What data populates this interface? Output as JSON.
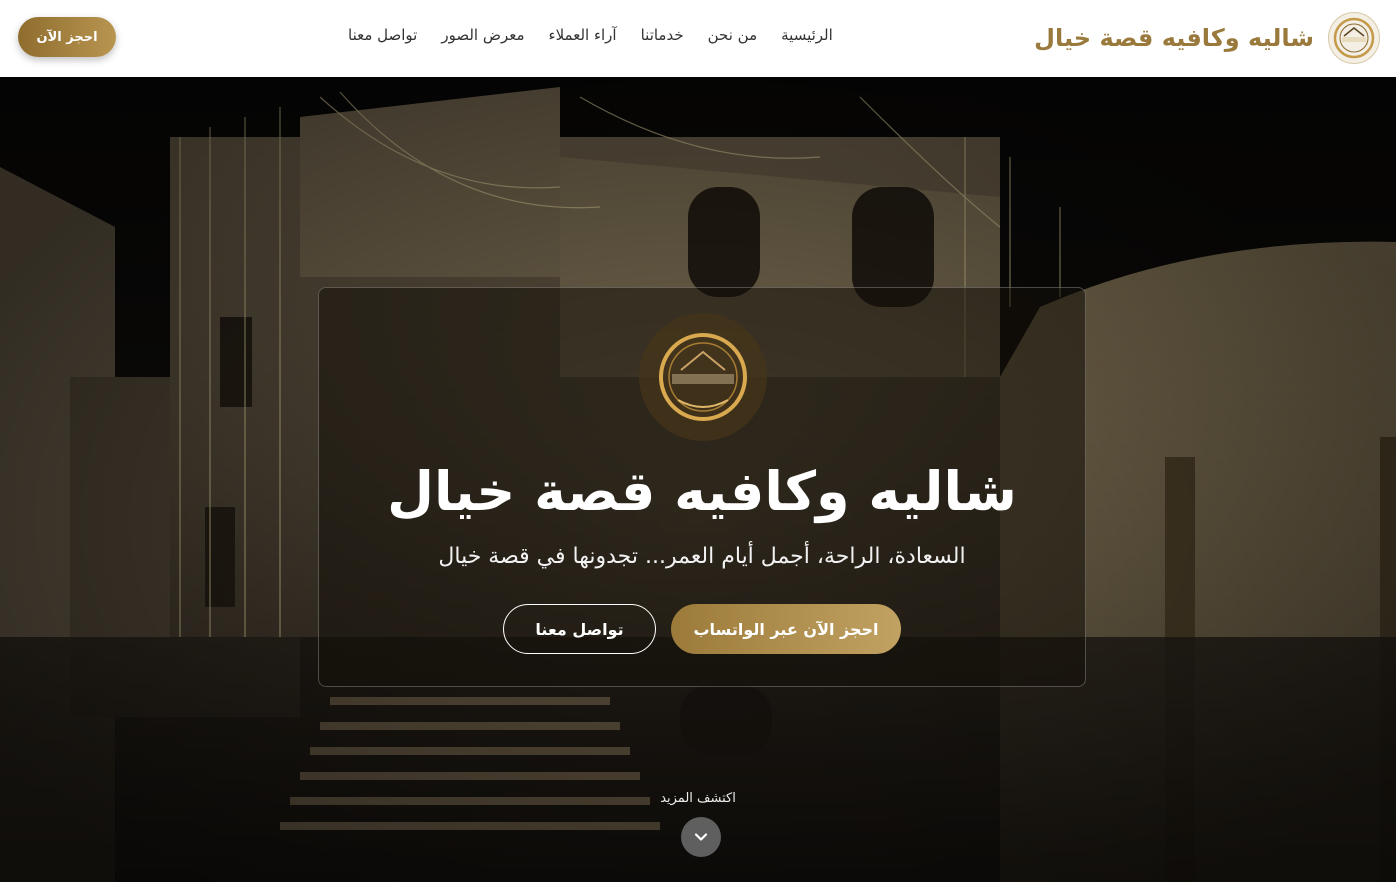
{
  "header": {
    "brand_title": "شاليه وكافيه قصة خيال",
    "brand_logo_icon": "khayal-story-logo-icon",
    "nav": [
      {
        "label": "الرئيسية"
      },
      {
        "label": "من نحن"
      },
      {
        "label": "خدماتنا"
      },
      {
        "label": "آراء العملاء"
      },
      {
        "label": "معرض الصور"
      },
      {
        "label": "تواصل معنا"
      }
    ],
    "cta_label": "احجز الآن"
  },
  "hero": {
    "title": "شاليه وكافيه قصة خيال",
    "subtitle": "السعادة، الراحة، أجمل أيام العمر... تجدونها في قصة خيال",
    "whatsapp_button": "احجز الآن عبر الواتساب",
    "contact_button": "تواصل معنا",
    "discover_label": "اكتشف المزيد",
    "scroll_icon": "chevron-down-icon"
  },
  "colors": {
    "brand_gold": "#9a7a3c",
    "button_gold_start": "#9b7a3a",
    "button_gold_end": "#c2a262",
    "header_bg": "#ffffff"
  }
}
